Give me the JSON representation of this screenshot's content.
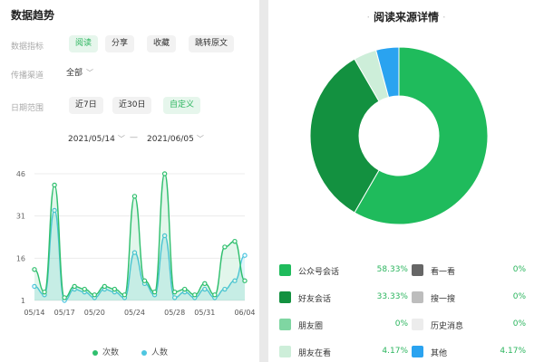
{
  "left": {
    "title": "数据趋势",
    "metric_label": "数据指标",
    "metric_chips": [
      "阅读",
      "分享",
      "收藏",
      "跳转原文"
    ],
    "channel_label": "传播渠道",
    "channel_value": "全部",
    "range_label": "日期范围",
    "range_chips": [
      "近7日",
      "近30日",
      "自定义"
    ],
    "start_date": "2021/05/14",
    "end_date": "2021/06/05",
    "separator": "—"
  },
  "chart_data": {
    "type": "area",
    "x": [
      "05/14",
      "05/15",
      "05/16",
      "05/17",
      "05/18",
      "05/19",
      "05/20",
      "05/21",
      "05/22",
      "05/23",
      "05/24",
      "05/25",
      "05/26",
      "05/27",
      "05/28",
      "05/29",
      "05/30",
      "05/31",
      "06/01",
      "06/02",
      "06/03",
      "06/04"
    ],
    "x_tick_labels": [
      "05/14",
      "05/17",
      "05/20",
      "05/24",
      "05/28",
      "05/31",
      "06/04"
    ],
    "y_tick_labels": [
      "46",
      "31",
      "16",
      "1"
    ],
    "ylim": [
      1,
      46
    ],
    "series": [
      {
        "name": "次数",
        "color": "#2fbf6e",
        "values": [
          12,
          4,
          42,
          2,
          6,
          5,
          3,
          6,
          5,
          3,
          38,
          8,
          4,
          46,
          4,
          5,
          3,
          7,
          3,
          20,
          22,
          8
        ]
      },
      {
        "name": "人数",
        "color": "#4ec6e0",
        "values": [
          6,
          3,
          33,
          1,
          5,
          4,
          2,
          5,
          4,
          2,
          18,
          7,
          3,
          24,
          2,
          4,
          2,
          5,
          2,
          5,
          8,
          17
        ]
      }
    ],
    "legend": "bottom"
  },
  "right": {
    "title": "阅读来源详情",
    "donut": [
      {
        "name": "公众号会话",
        "value": 58.33,
        "pct": "58.33%",
        "color": "#1fbb5c"
      },
      {
        "name": "好友会话",
        "value": 33.33,
        "pct": "33.33%",
        "color": "#139140"
      },
      {
        "name": "朋友圈",
        "value": 0,
        "pct": "0%",
        "color": "#7fd6a2"
      },
      {
        "name": "朋友在看",
        "value": 4.17,
        "pct": "4.17%",
        "color": "#cdeed9"
      },
      {
        "name": "看一看",
        "value": 0,
        "pct": "0%",
        "color": "#666666"
      },
      {
        "name": "搜一搜",
        "value": 0,
        "pct": "0%",
        "color": "#bdbdbd"
      },
      {
        "name": "历史消息",
        "value": 0,
        "pct": "0%",
        "color": "#ececec"
      },
      {
        "name": "其他",
        "value": 4.17,
        "pct": "4.17%",
        "color": "#2aa3f0"
      }
    ]
  }
}
